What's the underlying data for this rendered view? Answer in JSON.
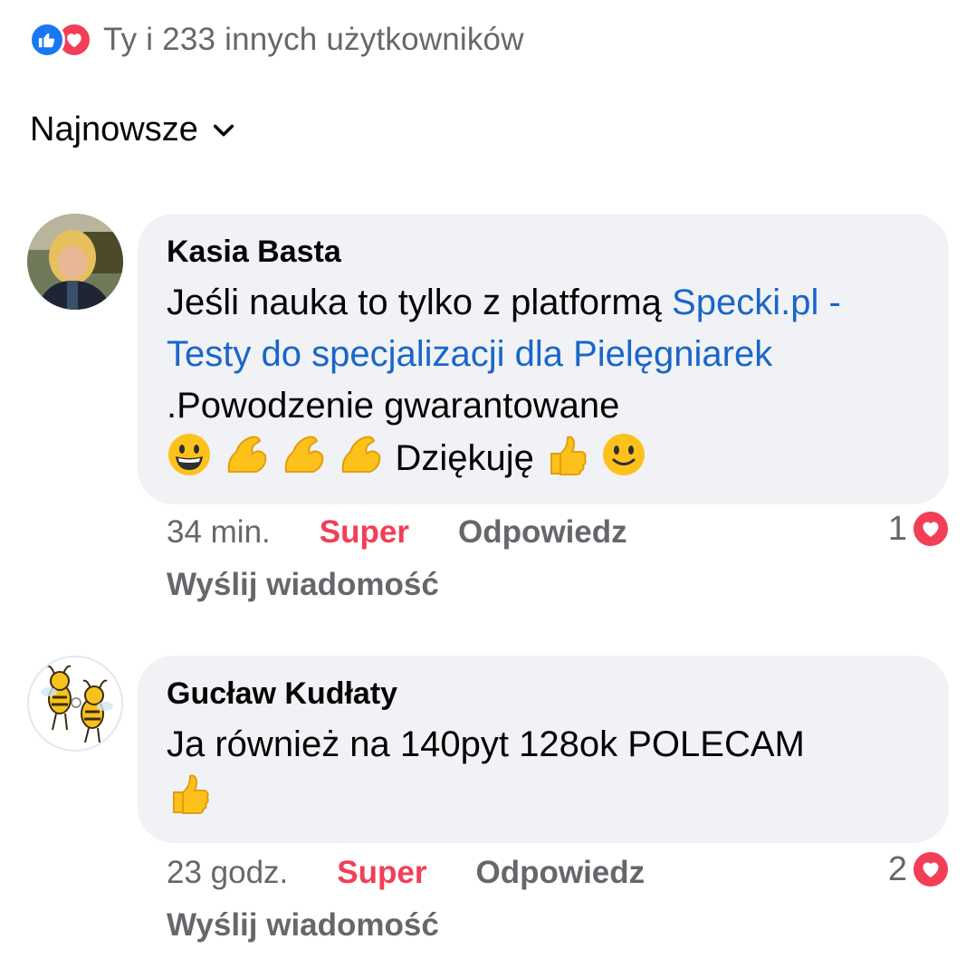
{
  "reactions_summary": {
    "text": "Ty i 233 innych użytkowników",
    "icons": [
      "like-icon",
      "love-icon"
    ],
    "colors": {
      "like": "#1877f2",
      "love": "#f33e58"
    }
  },
  "sort": {
    "label": "Najnowsze",
    "icon": "chevron-down-icon"
  },
  "comments": [
    {
      "author": "Kasia Basta",
      "text_before_link": "Jeśli nauka to tylko z platformą ",
      "link_text": "Specki.pl - Testy do specjalizacji dla Pielęgniarek",
      "text_after_link": " .Powodzenie gwarantowane ",
      "emojis_1": [
        "😀",
        "💪",
        "💪",
        "💪"
      ],
      "text_end": "Dziękuję ",
      "emojis_2": [
        "👍",
        "🙂"
      ],
      "time": "34 min.",
      "reaction_label": "Super",
      "reply_label": "Odpowiedz",
      "message_label": "Wyślij wiadomość",
      "reaction_count": "1"
    },
    {
      "author": "Gucław Kudłaty",
      "text": "Ja również na 140pyt 128ok POLECAM",
      "emojis": [
        "👍"
      ],
      "time": "23 godz.",
      "reaction_label": "Super",
      "reply_label": "Odpowiedz",
      "message_label": "Wyślij wiadomość",
      "reaction_count": "2"
    }
  ]
}
